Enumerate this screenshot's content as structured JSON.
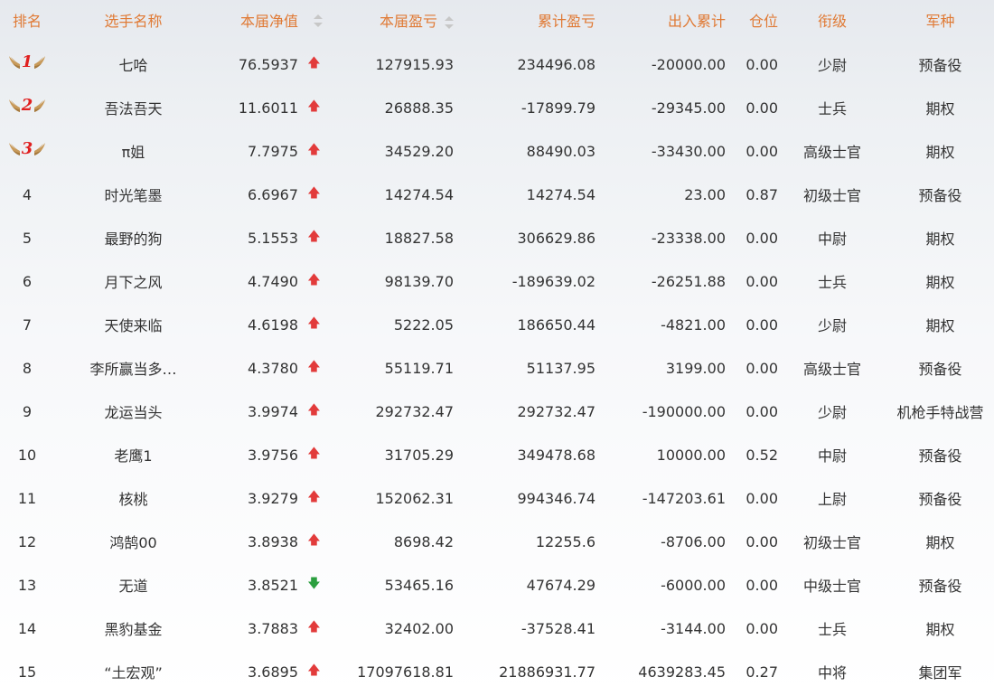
{
  "columns": {
    "rank": "排名",
    "name": "选手名称",
    "net_value": "本届净值",
    "profit": "本届盈亏",
    "total_profit": "累计盈亏",
    "in_out": "出入累计",
    "position": "仓位",
    "title": "衔级",
    "army": "军种"
  },
  "colors": {
    "header": "#e07a35",
    "up": "#e23b3b",
    "down": "#2b9f3f",
    "medal_wing": "#c89a5a"
  },
  "rows": [
    {
      "rank": "1",
      "name": "七哈",
      "net": "76.5937",
      "trend": "up",
      "profit": "127915.93",
      "total": "234496.08",
      "inout": "-20000.00",
      "pos": "0.00",
      "title": "少尉",
      "army": "预备役"
    },
    {
      "rank": "2",
      "name": "吾法吾天",
      "net": "11.6011",
      "trend": "up",
      "profit": "26888.35",
      "total": "-17899.79",
      "inout": "-29345.00",
      "pos": "0.00",
      "title": "士兵",
      "army": "期权"
    },
    {
      "rank": "3",
      "name": "π姐",
      "net": "7.7975",
      "trend": "up",
      "profit": "34529.20",
      "total": "88490.03",
      "inout": "-33430.00",
      "pos": "0.00",
      "title": "高级士官",
      "army": "期权"
    },
    {
      "rank": "4",
      "name": "时光笔墨",
      "net": "6.6967",
      "trend": "up",
      "profit": "14274.54",
      "total": "14274.54",
      "inout": "23.00",
      "pos": "0.87",
      "title": "初级士官",
      "army": "预备役"
    },
    {
      "rank": "5",
      "name": "最野的狗",
      "net": "5.1553",
      "trend": "up",
      "profit": "18827.58",
      "total": "306629.86",
      "inout": "-23338.00",
      "pos": "0.00",
      "title": "中尉",
      "army": "期权"
    },
    {
      "rank": "6",
      "name": "月下之风",
      "net": "4.7490",
      "trend": "up",
      "profit": "98139.70",
      "total": "-189639.02",
      "inout": "-26251.88",
      "pos": "0.00",
      "title": "士兵",
      "army": "期权"
    },
    {
      "rank": "7",
      "name": "天使来临",
      "net": "4.6198",
      "trend": "up",
      "profit": "5222.05",
      "total": "186650.44",
      "inout": "-4821.00",
      "pos": "0.00",
      "title": "少尉",
      "army": "期权"
    },
    {
      "rank": "8",
      "name": "李所赢当多…",
      "net": "4.3780",
      "trend": "up",
      "profit": "55119.71",
      "total": "51137.95",
      "inout": "3199.00",
      "pos": "0.00",
      "title": "高级士官",
      "army": "预备役"
    },
    {
      "rank": "9",
      "name": "龙运当头",
      "net": "3.9974",
      "trend": "up",
      "profit": "292732.47",
      "total": "292732.47",
      "inout": "-190000.00",
      "pos": "0.00",
      "title": "少尉",
      "army": "机枪手特战营"
    },
    {
      "rank": "10",
      "name": "老鹰1",
      "net": "3.9756",
      "trend": "up",
      "profit": "31705.29",
      "total": "349478.68",
      "inout": "10000.00",
      "pos": "0.52",
      "title": "中尉",
      "army": "预备役"
    },
    {
      "rank": "11",
      "name": "核桃",
      "net": "3.9279",
      "trend": "up",
      "profit": "152062.31",
      "total": "994346.74",
      "inout": "-147203.61",
      "pos": "0.00",
      "title": "上尉",
      "army": "预备役"
    },
    {
      "rank": "12",
      "name": "鸿鹄00",
      "net": "3.8938",
      "trend": "up",
      "profit": "8698.42",
      "total": "12255.6",
      "inout": "-8706.00",
      "pos": "0.00",
      "title": "初级士官",
      "army": "期权"
    },
    {
      "rank": "13",
      "name": "无道",
      "net": "3.8521",
      "trend": "down",
      "profit": "53465.16",
      "total": "47674.29",
      "inout": "-6000.00",
      "pos": "0.00",
      "title": "中级士官",
      "army": "预备役"
    },
    {
      "rank": "14",
      "name": "黑豹基金",
      "net": "3.7883",
      "trend": "up",
      "profit": "32402.00",
      "total": "-37528.41",
      "inout": "-3144.00",
      "pos": "0.00",
      "title": "士兵",
      "army": "期权"
    },
    {
      "rank": "15",
      "name": "“土宏观”",
      "net": "3.6895",
      "trend": "up",
      "profit": "17097618.81",
      "total": "21886931.77",
      "inout": "4639283.45",
      "pos": "0.27",
      "title": "中将",
      "army": "集团军"
    }
  ]
}
